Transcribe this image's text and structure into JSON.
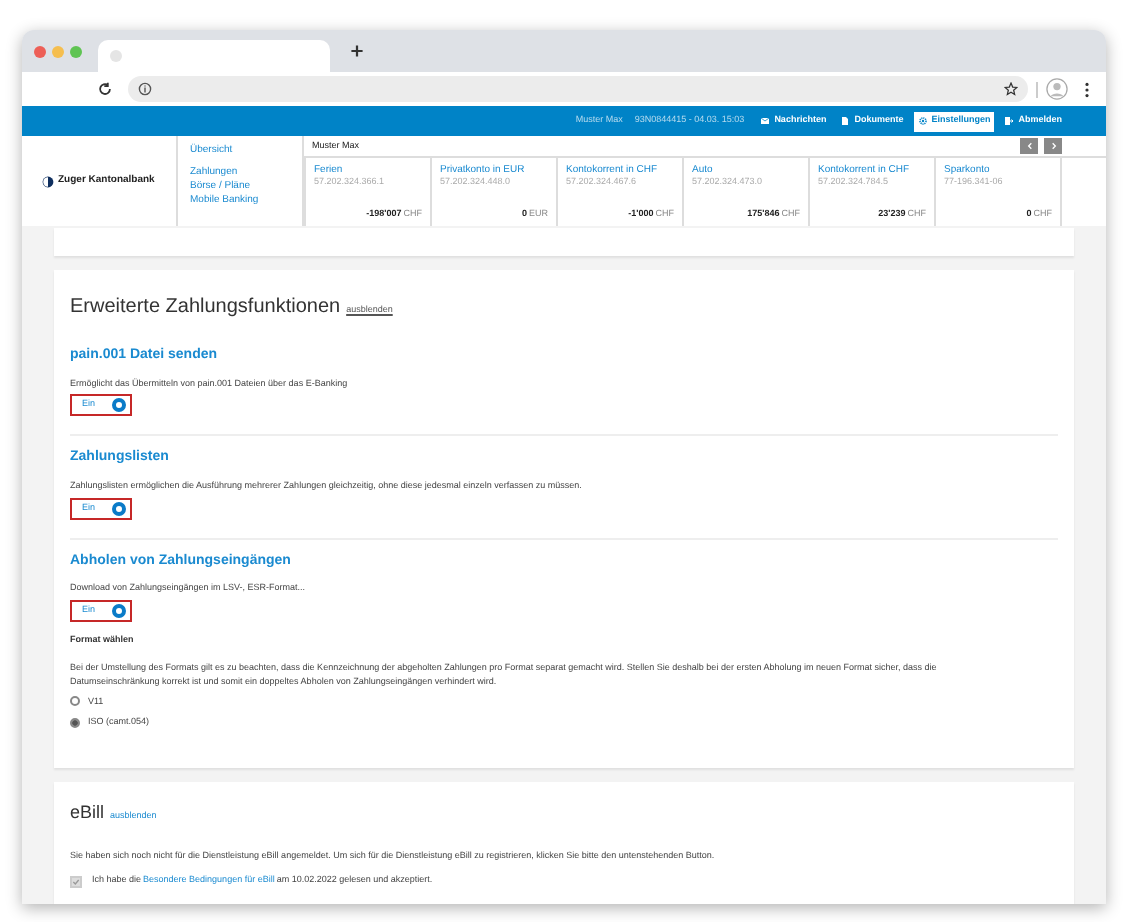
{
  "header": {
    "user": "Muster Max",
    "session": "93N0844415 - 04.03. 15:03",
    "nav": [
      {
        "label": "Nachrichten",
        "kind": "mail",
        "selected": false
      },
      {
        "label": "Dokumente",
        "kind": "doc",
        "selected": false
      },
      {
        "label": "Einstellungen",
        "kind": "gear",
        "selected": true
      },
      {
        "label": "Abmelden",
        "kind": "logout",
        "selected": false
      }
    ]
  },
  "logo": "Zuger Kantonalbank",
  "menu": [
    "Übersicht",
    "Zahlungen",
    "Börse / Pläne",
    "Mobile Banking"
  ],
  "accounts": {
    "owner": "Muster Max",
    "items": [
      {
        "name": "Ferien",
        "number": "57.202.324.366.1",
        "balance": "-198'007",
        "currency": "CHF"
      },
      {
        "name": "Privatkonto in EUR",
        "number": "57.202.324.448.0",
        "balance": "0",
        "currency": "EUR"
      },
      {
        "name": "Kontokorrent in CHF",
        "number": "57.202.324.467.6",
        "balance": "-1'000",
        "currency": "CHF"
      },
      {
        "name": "Auto",
        "number": "57.202.324.473.0",
        "balance": "175'846",
        "currency": "CHF"
      },
      {
        "name": "Kontokorrent in CHF",
        "number": "57.202.324.784.5",
        "balance": "23'239",
        "currency": "CHF"
      },
      {
        "name": "Sparkonto",
        "number": "77-196.341-06",
        "balance": "0",
        "currency": "CHF"
      }
    ]
  },
  "payment_functions": {
    "title": "Erweiterte Zahlungsfunktionen",
    "link": "ausblenden",
    "features": [
      {
        "title": "pain.001 Datei senden",
        "description": "Ermöglicht das Übermitteln von pain.001 Dateien über das E-Banking",
        "toggle": {
          "label": "Ein",
          "on": true
        }
      },
      {
        "title": "Zahlungslisten",
        "description": "Zahlungslisten ermöglichen die Ausführung mehrerer Zahlungen gleichzeitig, ohne diese jedesmal einzeln verfassen zu müssen.",
        "toggle": {
          "label": "Ein",
          "on": true
        }
      },
      {
        "title": "Abholen von Zahlungseingängen",
        "description": "Download von Zahlungseingängen im LSV-, ESR-Format...",
        "toggle": {
          "label": "Ein",
          "on": true
        },
        "format": {
          "title": "Format wählen",
          "text": "Bei der Umstellung des Formats gilt es zu beachten, dass die Kennzeichnung der abgeholten Zahlungen pro Format separat gemacht wird. Stellen Sie deshalb bei der ersten Abholung im neuen Format sicher, dass die Datumseinschränkung korrekt ist und somit ein doppeltes Abholen von Zahlungseingängen verhindert wird.",
          "options": [
            {
              "label": "V11",
              "selected": false
            },
            {
              "label": "ISO (camt.054)",
              "selected": true
            }
          ]
        }
      }
    ]
  },
  "ebill": {
    "title": "eBill",
    "link": "ausblenden",
    "text": "Sie haben sich noch nicht für die Dienstleistung eBill angemeldet. Um sich für die Dienstleistung eBill zu registrieren, klicken Sie bitte den untenstehenden Button.",
    "consent": {
      "checked": true,
      "disabled": true,
      "before": "Ich habe die",
      "link": "Besondere Bedingungen für eBill",
      "after": "am 10.02.2022 gelesen und akzeptiert."
    }
  }
}
